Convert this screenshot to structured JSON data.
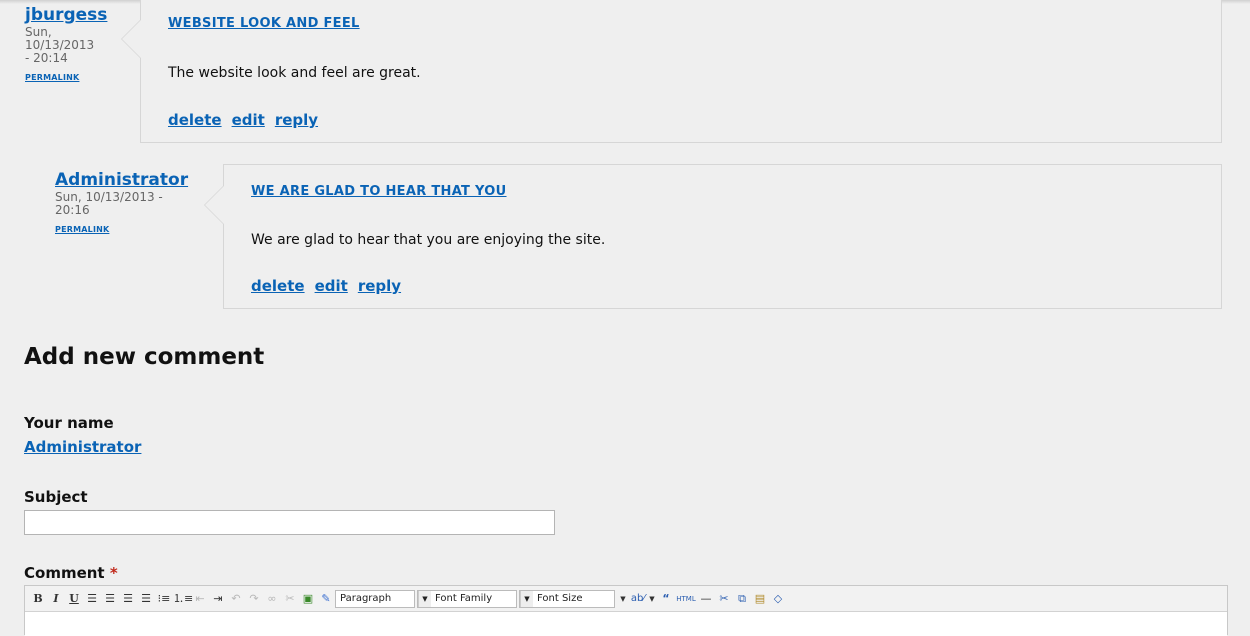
{
  "comments": [
    {
      "author": "jburgess",
      "date": "Sun, 10/13/2013 - 20:14",
      "permalink": "PERMALINK",
      "title": "WEBSITE LOOK AND FEEL",
      "body": "The website look and feel are great.",
      "links": [
        "delete",
        "edit",
        "reply"
      ]
    },
    {
      "author": "Administrator",
      "date": "Sun, 10/13/2013 - 20:16",
      "permalink": "PERMALINK",
      "title": "WE ARE GLAD TO HEAR THAT YOU",
      "body": "We are glad to hear that you are enjoying the site.",
      "links": [
        "delete",
        "edit",
        "reply"
      ]
    }
  ],
  "form": {
    "heading": "Add new comment",
    "name_label": "Your name",
    "name_value": "Administrator",
    "subject_label": "Subject",
    "subject_value": "",
    "comment_label": "Comment",
    "required_mark": "*"
  },
  "toolbar": {
    "buttons": [
      "B",
      "I",
      "U",
      "align-left-icon",
      "align-center-icon",
      "align-right-icon",
      "justify-icon",
      "bullet-list-icon",
      "numbered-list-icon",
      "outdent-icon",
      "indent-icon",
      "undo-icon",
      "redo-icon",
      "link-icon",
      "unlink-icon",
      "image-icon",
      "cleanup-icon"
    ],
    "format_select": "Paragraph",
    "font_family_select": "Font Family",
    "font_size_select": "Font Size",
    "extra_buttons": [
      "spellcheck-icon",
      "blockquote-icon",
      "html-icon",
      "horizontal-rule-icon",
      "cut-icon",
      "copy-icon",
      "paste-icon",
      "eraser-icon"
    ]
  }
}
